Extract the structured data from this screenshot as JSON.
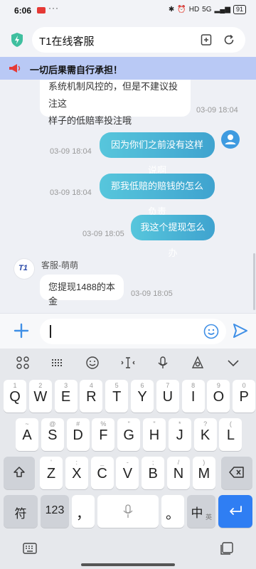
{
  "status_bar": {
    "time": "6:06",
    "dots": "···",
    "network": "HD",
    "signal": "5G",
    "battery": "91"
  },
  "browser": {
    "title": "T1在线客服"
  },
  "notice": {
    "text": "一切后果需自行承担！"
  },
  "chat": {
    "messages": [
      {
        "side": "left",
        "lines": [
          "系统机制风控的，但是不建议投注这",
          "样子的低赔率投注哦"
        ],
        "time": "03-09 18:04"
      },
      {
        "side": "right",
        "text": "因为你们之前没有这样说啊",
        "time": "03-09 18:04"
      },
      {
        "side": "right",
        "text": "那我低赔的赔钱的怎么负责",
        "time": "03-09 18:04"
      },
      {
        "side": "right",
        "text": "我这个提现怎么办",
        "time": "03-09 18:05"
      },
      {
        "side": "left",
        "sender": "客服-萌萌",
        "avatar_text": "T1",
        "text": "您提现1488的本金",
        "time": "03-09 18:05"
      }
    ]
  },
  "input": {
    "value": ""
  },
  "keyboard": {
    "row1": [
      {
        "k": "Q",
        "s": "1"
      },
      {
        "k": "W",
        "s": "2"
      },
      {
        "k": "E",
        "s": "3"
      },
      {
        "k": "R",
        "s": "4"
      },
      {
        "k": "T",
        "s": "5"
      },
      {
        "k": "Y",
        "s": "6"
      },
      {
        "k": "U",
        "s": "7"
      },
      {
        "k": "I",
        "s": "8"
      },
      {
        "k": "O",
        "s": "9"
      },
      {
        "k": "P",
        "s": "0"
      }
    ],
    "row2": [
      {
        "k": "A",
        "s": "~"
      },
      {
        "k": "S",
        "s": "@"
      },
      {
        "k": "D",
        "s": "#"
      },
      {
        "k": "F",
        "s": "%"
      },
      {
        "k": "G",
        "s": "\""
      },
      {
        "k": "H",
        "s": "\""
      },
      {
        "k": "J",
        "s": "*"
      },
      {
        "k": "K",
        "s": "?"
      },
      {
        "k": "L",
        "s": "("
      }
    ],
    "row3": [
      {
        "k": "Z",
        "s": "'"
      },
      {
        "k": "X",
        "s": ":"
      },
      {
        "k": "C",
        "s": "_"
      },
      {
        "k": "V",
        "s": "-"
      },
      {
        "k": "B",
        "s": ";"
      },
      {
        "k": "N",
        "s": "/"
      },
      {
        "k": "M",
        "s": ")"
      }
    ],
    "symbol_key": "符",
    "num_key": "123",
    "comma_key": "，",
    "period_key": "。",
    "lang_key": "中",
    "lang_sub": "英",
    "accent_color": "#2f7ef3"
  }
}
